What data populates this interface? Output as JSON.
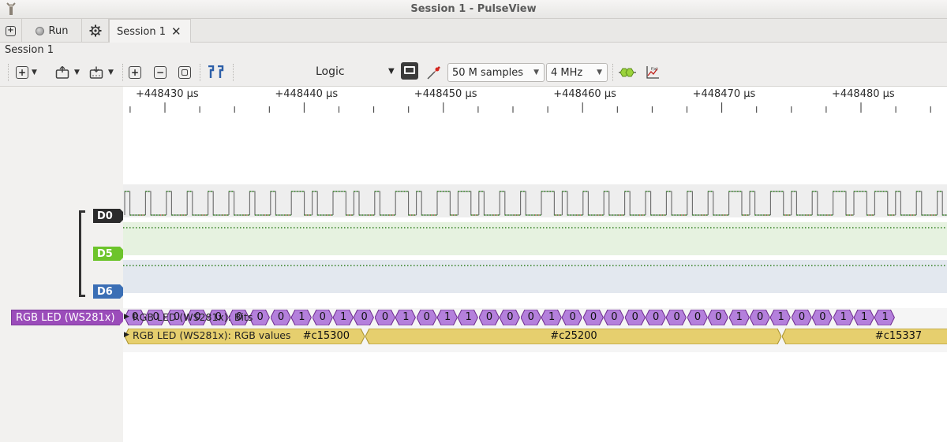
{
  "window": {
    "title": "Session 1 - PulseView"
  },
  "tabbar": {
    "run_label": "Run",
    "tab_label": "Session 1",
    "close_glyph": "✕"
  },
  "session": {
    "label": "Session 1"
  },
  "toolbar": {
    "device_label": "Logic",
    "samples": "50 M samples",
    "samplerate": "4 MHz"
  },
  "ruler": {
    "ticks": [
      "+448430 µs",
      "+448440 µs",
      "+448450 µs",
      "+448460 µs",
      "+448470 µs",
      "+448480 µs"
    ]
  },
  "channels": [
    {
      "name": "D0",
      "color": "#2b2b2b"
    },
    {
      "name": "D5",
      "color": "#6dc42b"
    },
    {
      "name": "D6",
      "color": "#3b6fb5"
    }
  ],
  "decoder": {
    "name": "RGB LED (WS281x)",
    "color": "#9b4cba",
    "bits_row": "RGB LED (WS281x): Bits",
    "rgb_row": "RGB LED (WS281x): RGB values",
    "bits": [
      "0",
      "0",
      "0",
      "0",
      "0",
      "0",
      "0",
      "0",
      "1",
      "0",
      "1",
      "0",
      "0",
      "1",
      "0",
      "1",
      "1",
      "0",
      "0",
      "0",
      "1",
      "0",
      "0",
      "0",
      "0",
      "0",
      "0",
      "0",
      "0",
      "1",
      "0",
      "1",
      "0",
      "0",
      "1",
      "1",
      "1"
    ],
    "rgb_values": [
      "#c15300",
      "#c25200",
      "#c15337"
    ]
  },
  "colors": {
    "decoder_bits": "#b480dc",
    "rgb_values": "#e6cf6e",
    "d5_bg": "#e6f2e0",
    "d6_bg": "#e3e8ef"
  }
}
